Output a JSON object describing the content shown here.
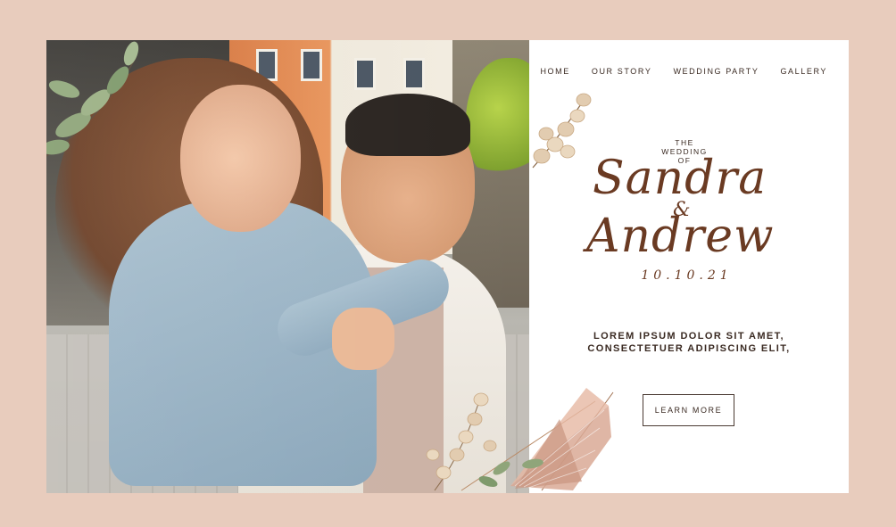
{
  "nav": {
    "items": [
      {
        "label": "HOME"
      },
      {
        "label": "OUR STORY"
      },
      {
        "label": "WEDDING PARTY"
      },
      {
        "label": "GALLERY"
      }
    ]
  },
  "hero": {
    "prefix_line1": "THE",
    "prefix_line2": "WEDDING",
    "prefix_line3": "OF",
    "name1": "Sandra",
    "ampersand": "&",
    "name2": "Andrew",
    "date": "10.10.21",
    "tagline_line1": "LOREM IPSUM DOLOR SIT AMET,",
    "tagline_line2": "CONSECTETUER ADIPISCING ELIT,",
    "button_label": "LEARN MORE"
  },
  "photo": {
    "alt": "couple-photo"
  },
  "colors": {
    "background": "#e8ccbd",
    "accent": "#6a3a22",
    "text": "#3a2a22"
  }
}
